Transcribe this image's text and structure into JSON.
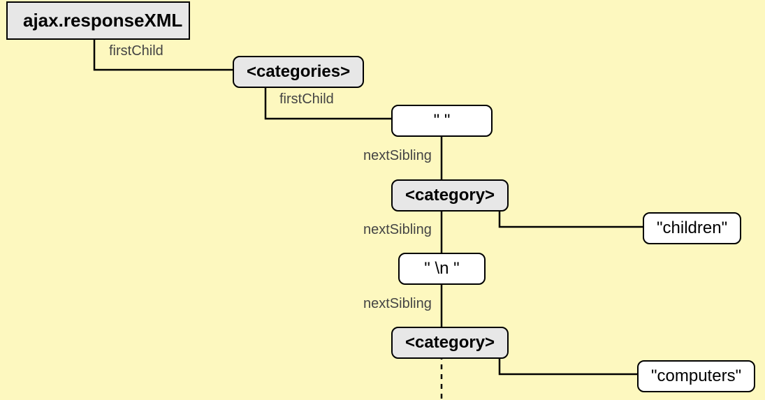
{
  "nodes": {
    "root": "ajax.responseXML",
    "categories": "<categories>",
    "ws1": "\"        \"",
    "category1": "<category>",
    "children": "\"children\"",
    "nl": "\"   \\n   \"",
    "category2": "<category>",
    "computers": "\"computers\""
  },
  "labels": {
    "firstChild1": "firstChild",
    "firstChild2": "firstChild",
    "nextSibling1": "nextSibling",
    "nextSibling2": "nextSibling",
    "nextSibling3": "nextSibling"
  }
}
